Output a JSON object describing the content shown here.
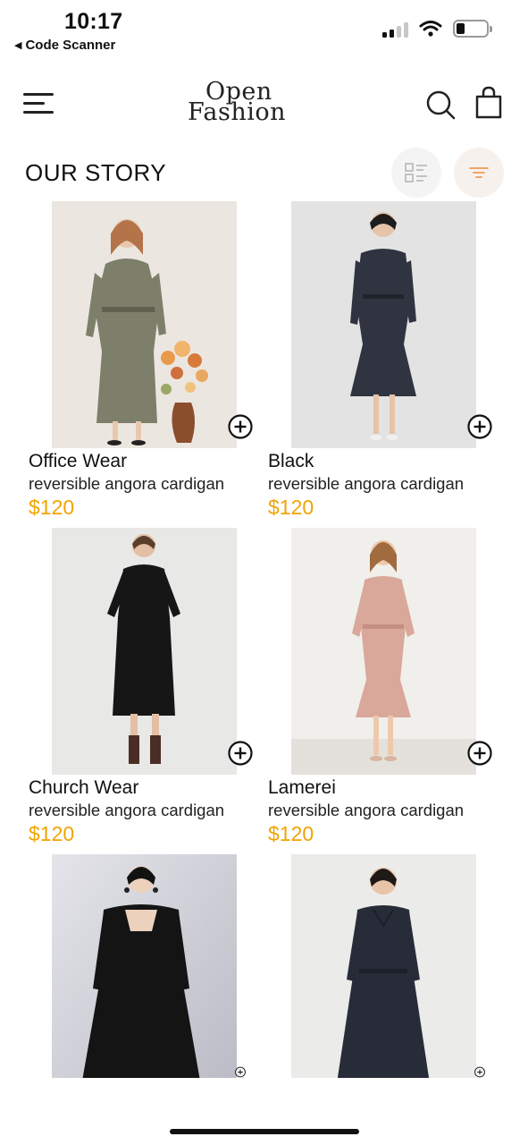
{
  "status_bar": {
    "time": "10:17",
    "back_app": "Code Scanner",
    "icons": [
      "signal-icon",
      "wifi-icon",
      "battery-icon"
    ]
  },
  "header": {
    "logo_line1": "Open",
    "logo_line2": "Fashion",
    "icons": [
      "menu-icon",
      "search-icon",
      "shopping-bag-icon"
    ]
  },
  "section": {
    "title": "OUR STORY",
    "view_toggle_icon": "list-view-icon",
    "filter_icon": "filter-icon"
  },
  "colors": {
    "price": "#f0a400",
    "filter_button_bg": "#f7f1ee",
    "view_button_bg": "#f4f4f4"
  },
  "products": [
    {
      "name": "Office Wear",
      "description": "reversible angora cardigan",
      "price": "$120"
    },
    {
      "name": "Black",
      "description": "reversible angora cardigan",
      "price": "$120"
    },
    {
      "name": "Church Wear",
      "description": "reversible angora cardigan",
      "price": "$120"
    },
    {
      "name": "Lamerei",
      "description": "reversible angora cardigan",
      "price": "$120"
    },
    {
      "name": "",
      "description": "",
      "price": ""
    },
    {
      "name": "",
      "description": "",
      "price": ""
    }
  ]
}
